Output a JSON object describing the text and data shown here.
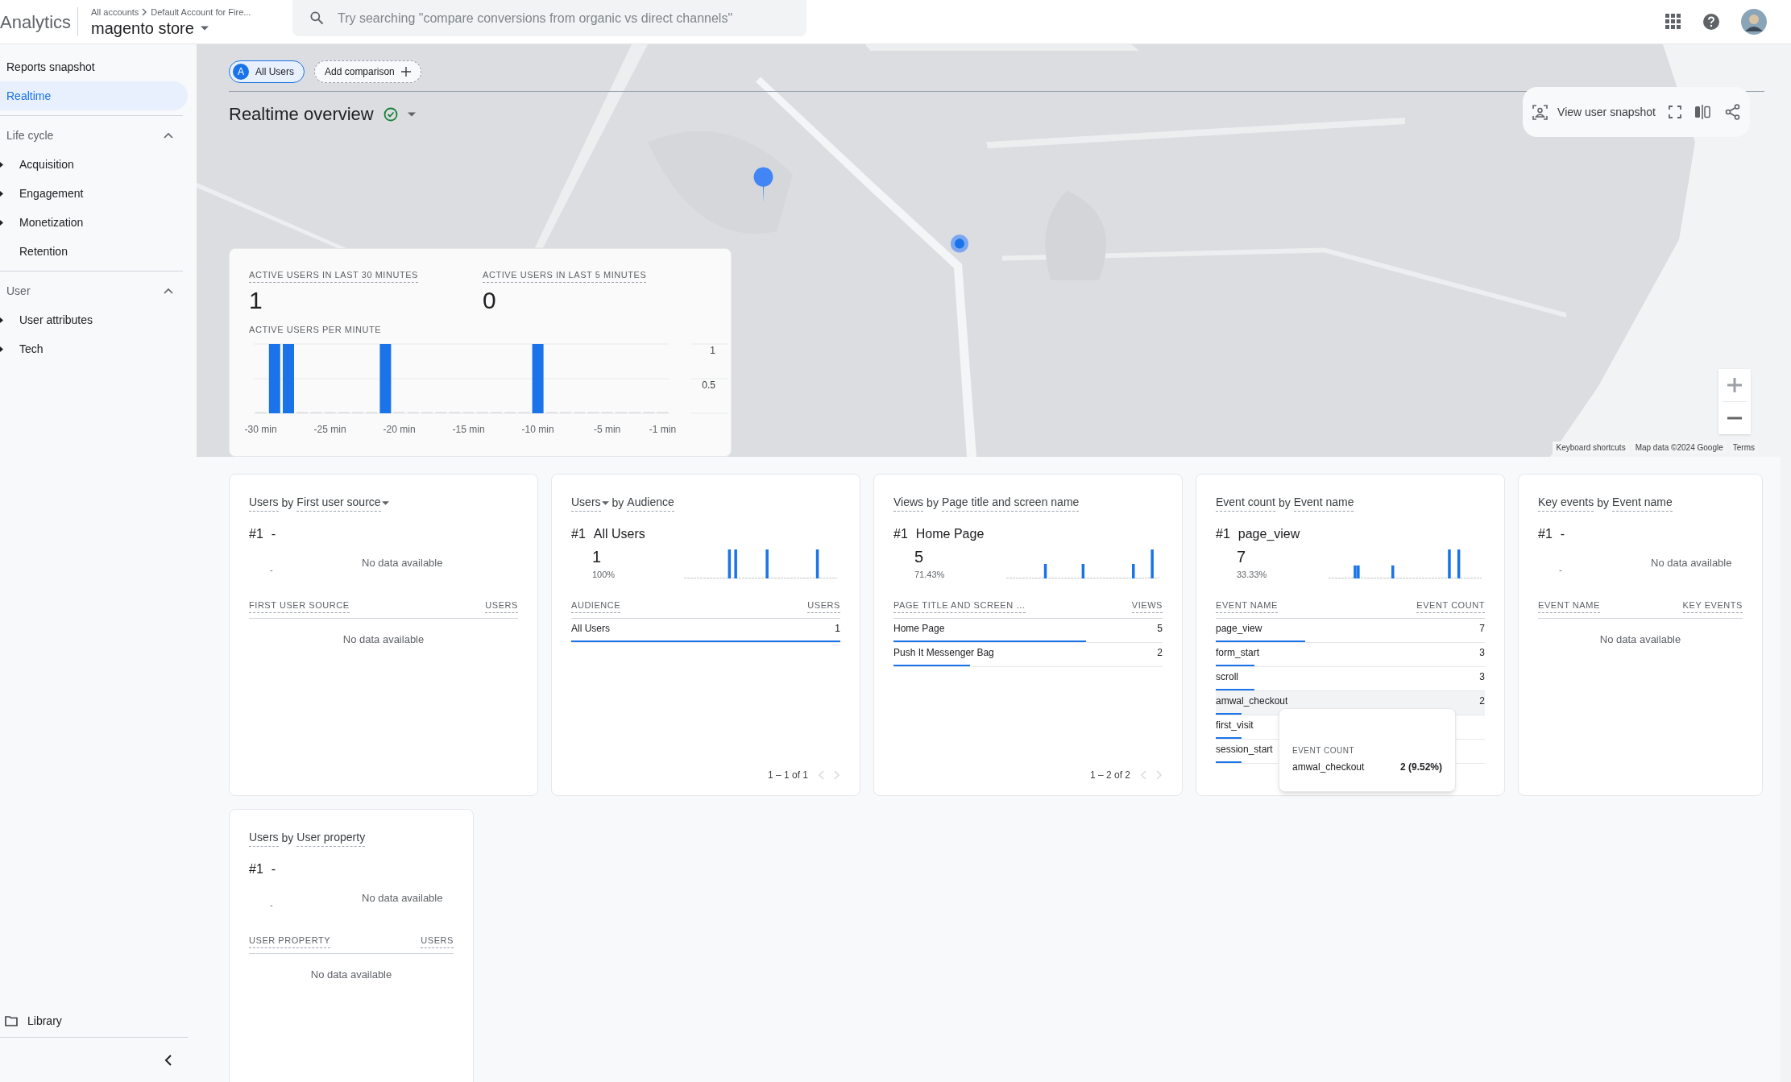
{
  "header": {
    "product": "Analytics",
    "breadcrumb": [
      "All accounts",
      "Default Account for Fire..."
    ],
    "property": "magento store",
    "search_placeholder": "Try searching \"compare conversions from organic vs direct channels\""
  },
  "sidebar": {
    "top_items": [
      {
        "label": "Reports snapshot",
        "selected": false
      },
      {
        "label": "Realtime",
        "selected": true
      }
    ],
    "sections": [
      {
        "title": "Life cycle",
        "expanded": true,
        "items": [
          {
            "label": "Acquisition",
            "expandable": true
          },
          {
            "label": "Engagement",
            "expandable": true
          },
          {
            "label": "Monetization",
            "expandable": true
          },
          {
            "label": "Retention",
            "expandable": false
          }
        ]
      },
      {
        "title": "User",
        "expanded": true,
        "items": [
          {
            "label": "User attributes",
            "expandable": true
          },
          {
            "label": "Tech",
            "expandable": true
          }
        ]
      }
    ],
    "library": "Library"
  },
  "comparisons": {
    "chips": [
      {
        "avatar": "A",
        "label": "All Users"
      }
    ],
    "add": "Add comparison"
  },
  "page_title": "Realtime overview",
  "map": {
    "kind": "picture",
    "toolbar_label": "View user snapshot",
    "attribution": [
      "Keyboard shortcuts",
      "Map data ©2024 Google",
      "Terms"
    ]
  },
  "overview": {
    "metrics": [
      {
        "label": "ACTIVE USERS IN LAST 30 MINUTES",
        "value": "1"
      },
      {
        "label": "ACTIVE USERS IN LAST 5 MINUTES",
        "value": "0"
      }
    ],
    "chart_data": {
      "type": "bar",
      "title": "ACTIVE USERS PER MINUTE",
      "x": [
        -30,
        -29,
        -28,
        -27,
        -26,
        -25,
        -24,
        -23,
        -22,
        -21,
        -20,
        -19,
        -18,
        -17,
        -16,
        -15,
        -14,
        -13,
        -12,
        -11,
        -10,
        -9,
        -8,
        -7,
        -6,
        -5,
        -4,
        -3,
        -2,
        -1
      ],
      "values": [
        0,
        1,
        1,
        0,
        0,
        0,
        0,
        0,
        0,
        1,
        0,
        0,
        0,
        0,
        0,
        0,
        0,
        0,
        0,
        0,
        1,
        0,
        0,
        0,
        0,
        0,
        0,
        0,
        0,
        0
      ],
      "xticks": [
        {
          "value": -30,
          "label": "-30 min"
        },
        {
          "value": -25,
          "label": "-25 min"
        },
        {
          "value": -20,
          "label": "-20 min"
        },
        {
          "value": -15,
          "label": "-15 min"
        },
        {
          "value": -10,
          "label": "-10 min"
        },
        {
          "value": -5,
          "label": "-5 min"
        },
        {
          "value": -1,
          "label": "-1 min"
        }
      ],
      "xlim": [
        -30.5,
        -0.5
      ],
      "ylim": [
        0,
        1
      ],
      "yticks": [
        {
          "value": 1,
          "label": "1"
        },
        {
          "value": 0.5,
          "label": "0.5"
        }
      ]
    }
  },
  "cards": [
    {
      "title": [
        {
          "text": "Users",
          "dropdown": false
        },
        {
          "text": "First user source",
          "dropdown": true
        }
      ],
      "connector": "by",
      "top": {
        "rank": "#1",
        "name": "-",
        "value": "-",
        "chart_note": "No data available"
      },
      "columns": [
        "FIRST USER SOURCE",
        "USERS"
      ],
      "empty": "No data available"
    },
    {
      "title": [
        {
          "text": "Users",
          "dropdown": true
        },
        {
          "text": "Audience",
          "dropdown": false
        }
      ],
      "connector": "by",
      "top": {
        "rank": "#1",
        "name": "All Users",
        "value": "1",
        "share": "100%"
      },
      "columns": [
        "AUDIENCE",
        "USERS"
      ],
      "rows": [
        {
          "label": "All Users",
          "value": "1",
          "level": 1,
          "highlighted": false
        }
      ],
      "pagination": {
        "text": "1 – 1 of 1",
        "prev_disabled": true,
        "next_disabled": true
      }
    },
    {
      "title": [
        {
          "text": "Views",
          "dropdown": false
        },
        {
          "text": "Page title and screen name",
          "dropdown": false
        }
      ],
      "connector": "by",
      "top": {
        "rank": "#1",
        "name": "Home Page",
        "value": "5",
        "share": "71.43%"
      },
      "columns": [
        "PAGE TITLE AND SCREEN …",
        "VIEWS"
      ],
      "rows": [
        {
          "label": "Home Page",
          "value": "5",
          "level": 0.7143,
          "highlighted": false
        },
        {
          "label": "Push It Messenger Bag",
          "value": "2",
          "level": 0.2857,
          "highlighted": false
        }
      ],
      "pagination": {
        "text": "1 – 2 of 2",
        "prev_disabled": true,
        "next_disabled": true
      }
    },
    {
      "title": [
        {
          "text": "Event count",
          "dropdown": false
        },
        {
          "text": "Event name",
          "dropdown": false
        }
      ],
      "connector": "by",
      "top": {
        "rank": "#1",
        "name": "page_view",
        "value": "7",
        "share": "33.33%"
      },
      "columns": [
        "EVENT NAME",
        "EVENT COUNT"
      ],
      "rows": [
        {
          "label": "page_view",
          "value": "7",
          "level": 0.3333,
          "highlighted": false
        },
        {
          "label": "form_start",
          "value": "3",
          "level": 0.1429,
          "highlighted": false
        },
        {
          "label": "scroll",
          "value": "3",
          "level": 0.1429,
          "highlighted": false
        },
        {
          "label": "amwal_checkout",
          "value": "2",
          "level": 0.0952,
          "highlighted": true
        },
        {
          "label": "first_visit",
          "level": 0.0952,
          "highlighted": false
        },
        {
          "label": "session_start",
          "level": 0.0952,
          "highlighted": false
        }
      ],
      "tooltip": {
        "heading": "EVENT COUNT",
        "label": "amwal_checkout",
        "value": "2 (9.52%)"
      }
    },
    {
      "title": [
        {
          "text": "Key events",
          "dropdown": false
        },
        {
          "text": "Event name",
          "dropdown": false
        }
      ],
      "connector": "by",
      "top": {
        "rank": "#1",
        "name": "-",
        "value": "-",
        "chart_note": "No data available"
      },
      "columns": [
        "EVENT NAME",
        "KEY EVENTS"
      ],
      "empty": "No data available"
    },
    {
      "title": [
        {
          "text": "Users",
          "dropdown": false
        },
        {
          "text": "User property",
          "dropdown": false
        }
      ],
      "connector": "by",
      "top": {
        "rank": "#1",
        "name": "-",
        "value": "-",
        "chart_note": "No data available"
      },
      "columns": [
        "USER PROPERTY",
        "USERS"
      ],
      "empty": "No data available"
    }
  ]
}
